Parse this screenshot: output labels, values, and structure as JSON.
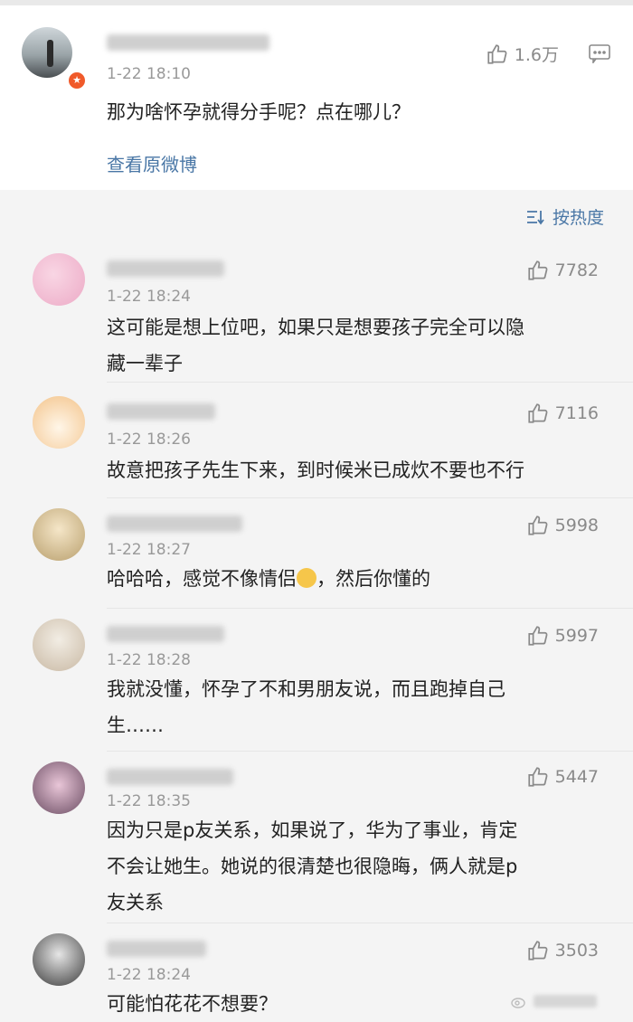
{
  "post": {
    "time": "1-22 18:10",
    "text": "那为啥怀孕就得分手呢？点在哪儿？",
    "likes": "1.6万",
    "view_link": "查看原微博"
  },
  "sort_label": "按热度",
  "comments": [
    {
      "time": "1-22 18:24",
      "likes": "7782",
      "lines": [
        "这可能是想上位吧，如果只是想要孩子完全可以隐",
        "藏一辈子"
      ]
    },
    {
      "time": "1-22 18:26",
      "likes": "7116",
      "lines": [
        "故意把孩子先生下来，到时候米已成炊不要也不行"
      ]
    },
    {
      "time": "1-22 18:27",
      "likes": "5998",
      "lines": [
        "哈哈哈，感觉不像情侣",
        "，然后你懂的"
      ]
    },
    {
      "time": "1-22 18:28",
      "likes": "5997",
      "lines": [
        "我就没懂，怀孕了不和男朋友说，而且跑掉自己",
        "生……"
      ]
    },
    {
      "time": "1-22 18:35",
      "likes": "5447",
      "lines": [
        "因为只是p友关系，如果说了，华为了事业，肯定",
        "不会让她生。她说的很清楚也很隐晦，俩人就是p",
        "友关系"
      ]
    },
    {
      "time": "1-22 18:24",
      "likes": "3503",
      "lines": [
        "可能怕花花不想要？"
      ]
    }
  ],
  "colors": {
    "link": "#4a77a6",
    "badge": "#f05a2a"
  }
}
